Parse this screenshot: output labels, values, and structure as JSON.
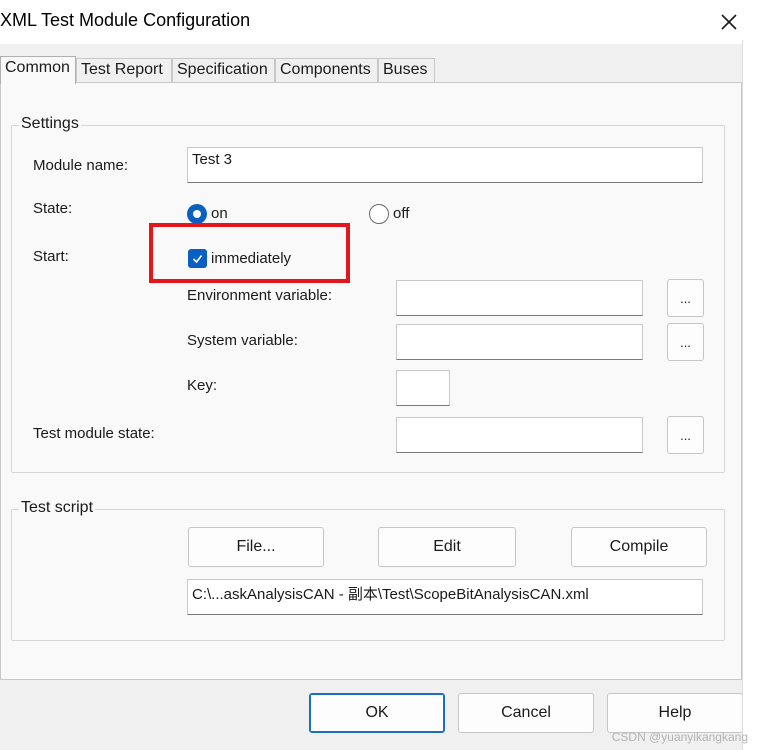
{
  "window": {
    "title": "XML Test Module Configuration"
  },
  "tabs": [
    {
      "label": "Common",
      "active": true
    },
    {
      "label": "Test Report",
      "active": false
    },
    {
      "label": "Specification",
      "active": false
    },
    {
      "label": "Components",
      "active": false
    },
    {
      "label": "Buses",
      "active": false
    }
  ],
  "settings": {
    "group_label": "Settings",
    "module_name_label": "Module name:",
    "module_name_value": "Test 3",
    "state_label": "State:",
    "state_on_label": "on",
    "state_off_label": "off",
    "state_selected": "on",
    "start_label": "Start:",
    "immediately_label": "immediately",
    "immediately_checked": true,
    "env_var_label": "Environment variable:",
    "env_var_value": "",
    "sys_var_label": "System variable:",
    "sys_var_value": "",
    "key_label": "Key:",
    "key_value": "",
    "test_module_state_label": "Test module state:",
    "test_module_state_value": "",
    "browse_label": "..."
  },
  "test_script": {
    "group_label": "Test script",
    "file_button": "File...",
    "edit_button": "Edit",
    "compile_button": "Compile",
    "path_value": "C:\\...askAnalysisCAN - 副本\\Test\\ScopeBitAnalysisCAN.xml"
  },
  "footer": {
    "ok_label": "OK",
    "cancel_label": "Cancel",
    "help_label": "Help"
  },
  "watermark": "CSDN @yuanyikangkang",
  "colors": {
    "accent": "#0a5fc2",
    "highlight": "#e4161c",
    "dialog_bg": "#f0f0f0",
    "page_bg": "#f9f9f9"
  }
}
